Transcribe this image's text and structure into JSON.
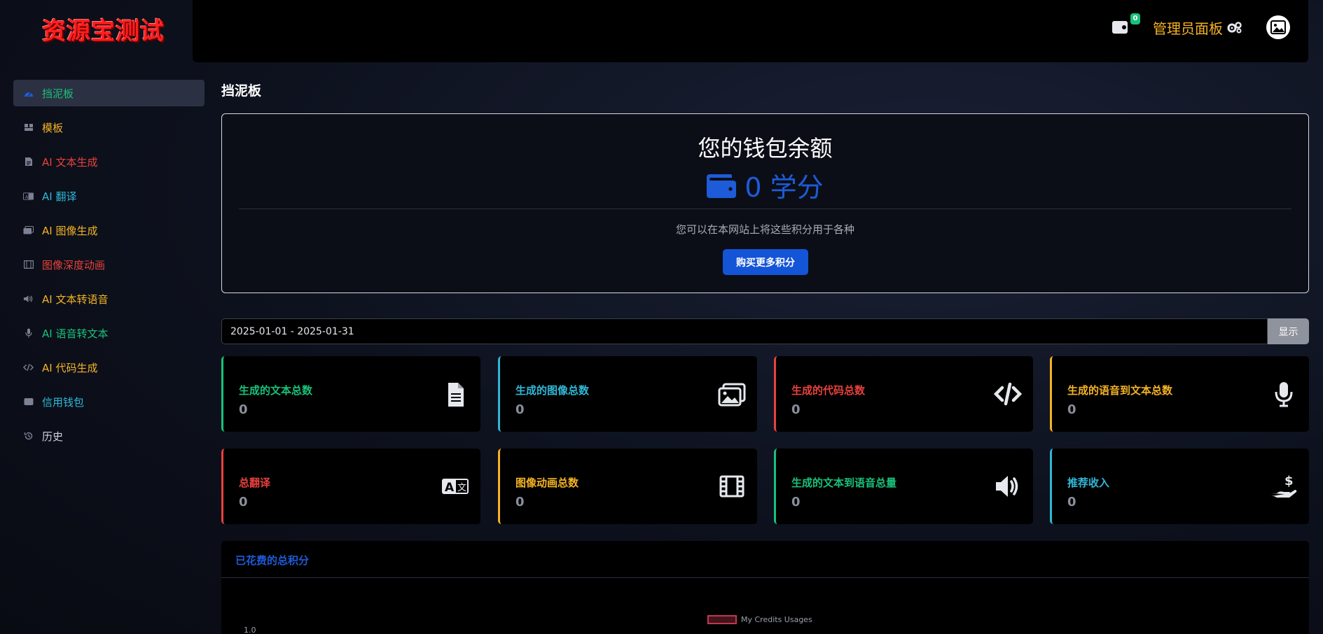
{
  "brand": {
    "title": "资源宝测试"
  },
  "topbar": {
    "wallet_badge": "0",
    "admin_label": "管理员面板"
  },
  "sidebar": {
    "items": [
      {
        "label": "挡泥板",
        "color": "#19c27a",
        "icon": "dashboard-icon",
        "active": true
      },
      {
        "label": "模板",
        "color": "#f5b324",
        "icon": "templates-icon"
      },
      {
        "label": "AI 文本生成",
        "color": "#e8413c",
        "icon": "document-icon"
      },
      {
        "label": "AI 翻译",
        "color": "#2fb8d8",
        "icon": "translate-icon"
      },
      {
        "label": "AI 图像生成",
        "color": "#f5b324",
        "icon": "images-icon"
      },
      {
        "label": "图像深度动画",
        "color": "#e8413c",
        "icon": "film-icon"
      },
      {
        "label": "AI 文本转语音",
        "color": "#f5b324",
        "icon": "speaker-icon"
      },
      {
        "label": "AI 语音转文本",
        "color": "#19c27a",
        "icon": "microphone-icon"
      },
      {
        "label": "AI 代码生成",
        "color": "#f5b324",
        "icon": "code-icon"
      },
      {
        "label": "信用钱包",
        "color": "#2fb8d8",
        "icon": "wallet-icon"
      },
      {
        "label": "历史",
        "color": "#cfd3dc",
        "icon": "history-icon"
      }
    ]
  },
  "main": {
    "page_title": "挡泥板",
    "wallet": {
      "title": "您的钱包余额",
      "amount": "0 学分",
      "description": "您可以在本网站上将这些积分用于各种",
      "buy_button": "购买更多积分"
    },
    "date_range": {
      "value": "2025-01-01 - 2025-01-31",
      "show_button": "显示"
    },
    "stats": [
      {
        "label": "生成的文本总数",
        "value": "0",
        "color": "#19c27a",
        "icon": "document-icon"
      },
      {
        "label": "生成的图像总数",
        "value": "0",
        "color": "#2fb8d8",
        "icon": "images-icon"
      },
      {
        "label": "生成的代码总数",
        "value": "0",
        "color": "#e8413c",
        "icon": "code-icon"
      },
      {
        "label": "生成的语音到文本总数",
        "value": "0",
        "color": "#f5b324",
        "icon": "microphone-icon"
      },
      {
        "label": "总翻译",
        "value": "0",
        "color": "#e8413c",
        "icon": "translate-icon"
      },
      {
        "label": "图像动画总数",
        "value": "0",
        "color": "#f5b324",
        "icon": "film-icon"
      },
      {
        "label": "生成的文本到语音总量",
        "value": "0",
        "color": "#19c27a",
        "icon": "speaker-icon"
      },
      {
        "label": "推荐收入",
        "value": "0",
        "color": "#2fb8d8",
        "icon": "hand-dollar-icon"
      }
    ],
    "chart": {
      "title": "已花费的总积分",
      "legend": "My Credits Usages",
      "y_tick": "1.0"
    }
  }
}
